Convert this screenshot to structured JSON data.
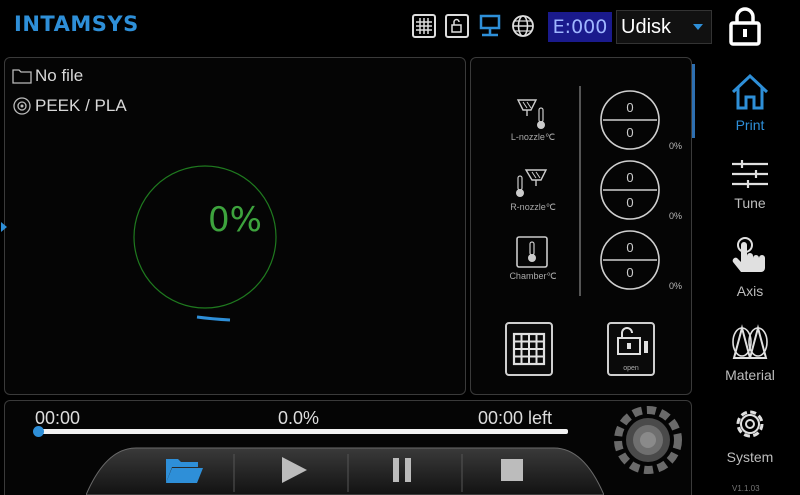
{
  "header": {
    "logo": "INTAMSYS",
    "error_code": "E:000",
    "storage": {
      "selected": "Udisk"
    }
  },
  "status": {
    "file": "No file",
    "material": "PEEK / PLA",
    "progress_percent": "0%",
    "progress_value": 0.0
  },
  "temperatures": [
    {
      "label": "L-nozzle℃",
      "current": "0",
      "target": "0",
      "power": "0%"
    },
    {
      "label": "R-nozzle℃",
      "current": "0",
      "target": "0",
      "power": "0%"
    },
    {
      "label": "Chamber℃",
      "current": "0",
      "target": "0",
      "power": "0%"
    }
  ],
  "door_button_label": "open",
  "progress_bar": {
    "elapsed": "00:00",
    "percent": "0.0%",
    "remaining": "00:00 left",
    "value": 0.0
  },
  "nav": [
    {
      "label": "Print",
      "icon": "home-icon",
      "active": true
    },
    {
      "label": "Tune",
      "icon": "sliders-icon",
      "active": false
    },
    {
      "label": "Axis",
      "icon": "hand-pointer-icon",
      "active": false
    },
    {
      "label": "Material",
      "icon": "spools-icon",
      "active": false
    },
    {
      "label": "System",
      "icon": "gear-icon",
      "active": false
    }
  ],
  "version": "V1.1.03",
  "colors": {
    "accent": "#2e8fd8",
    "progress_ring": "#3da33d",
    "error_bg": "#1a1a8c"
  }
}
